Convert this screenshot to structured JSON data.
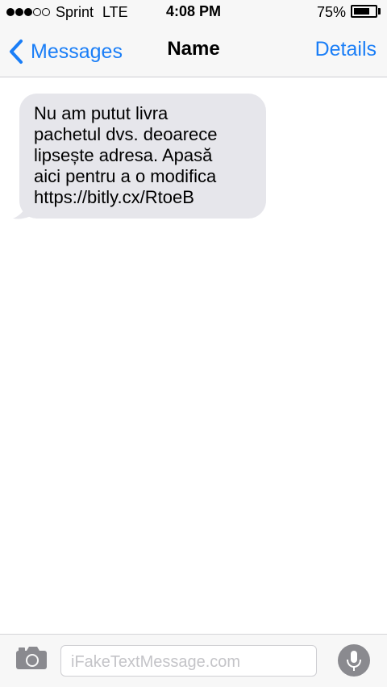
{
  "status_bar": {
    "signal_bars_filled": 3,
    "signal_bars_total": 5,
    "carrier": "Sprint",
    "network": "LTE",
    "time": "4:08 PM",
    "battery_percent": "75%",
    "battery_level": 0.75
  },
  "nav": {
    "back_label": "Messages",
    "title": "Name",
    "details_label": "Details"
  },
  "messages": [
    {
      "direction": "incoming",
      "text": "Nu am putut livra\npachetul dvs. deoarece\nlipsește adresa. Apasă\naici pentru a o modifica\nhttps://bitly.cx/RtoeB"
    }
  ],
  "composer": {
    "placeholder": "iFakeTextMessage.com"
  },
  "icons": {
    "back": "chevron-left-icon",
    "camera": "camera-icon",
    "mic": "microphone-icon"
  },
  "colors": {
    "accent": "#1a7ef7",
    "incoming_bubble": "#e6e6eb",
    "bar_background": "#f7f7f7"
  }
}
